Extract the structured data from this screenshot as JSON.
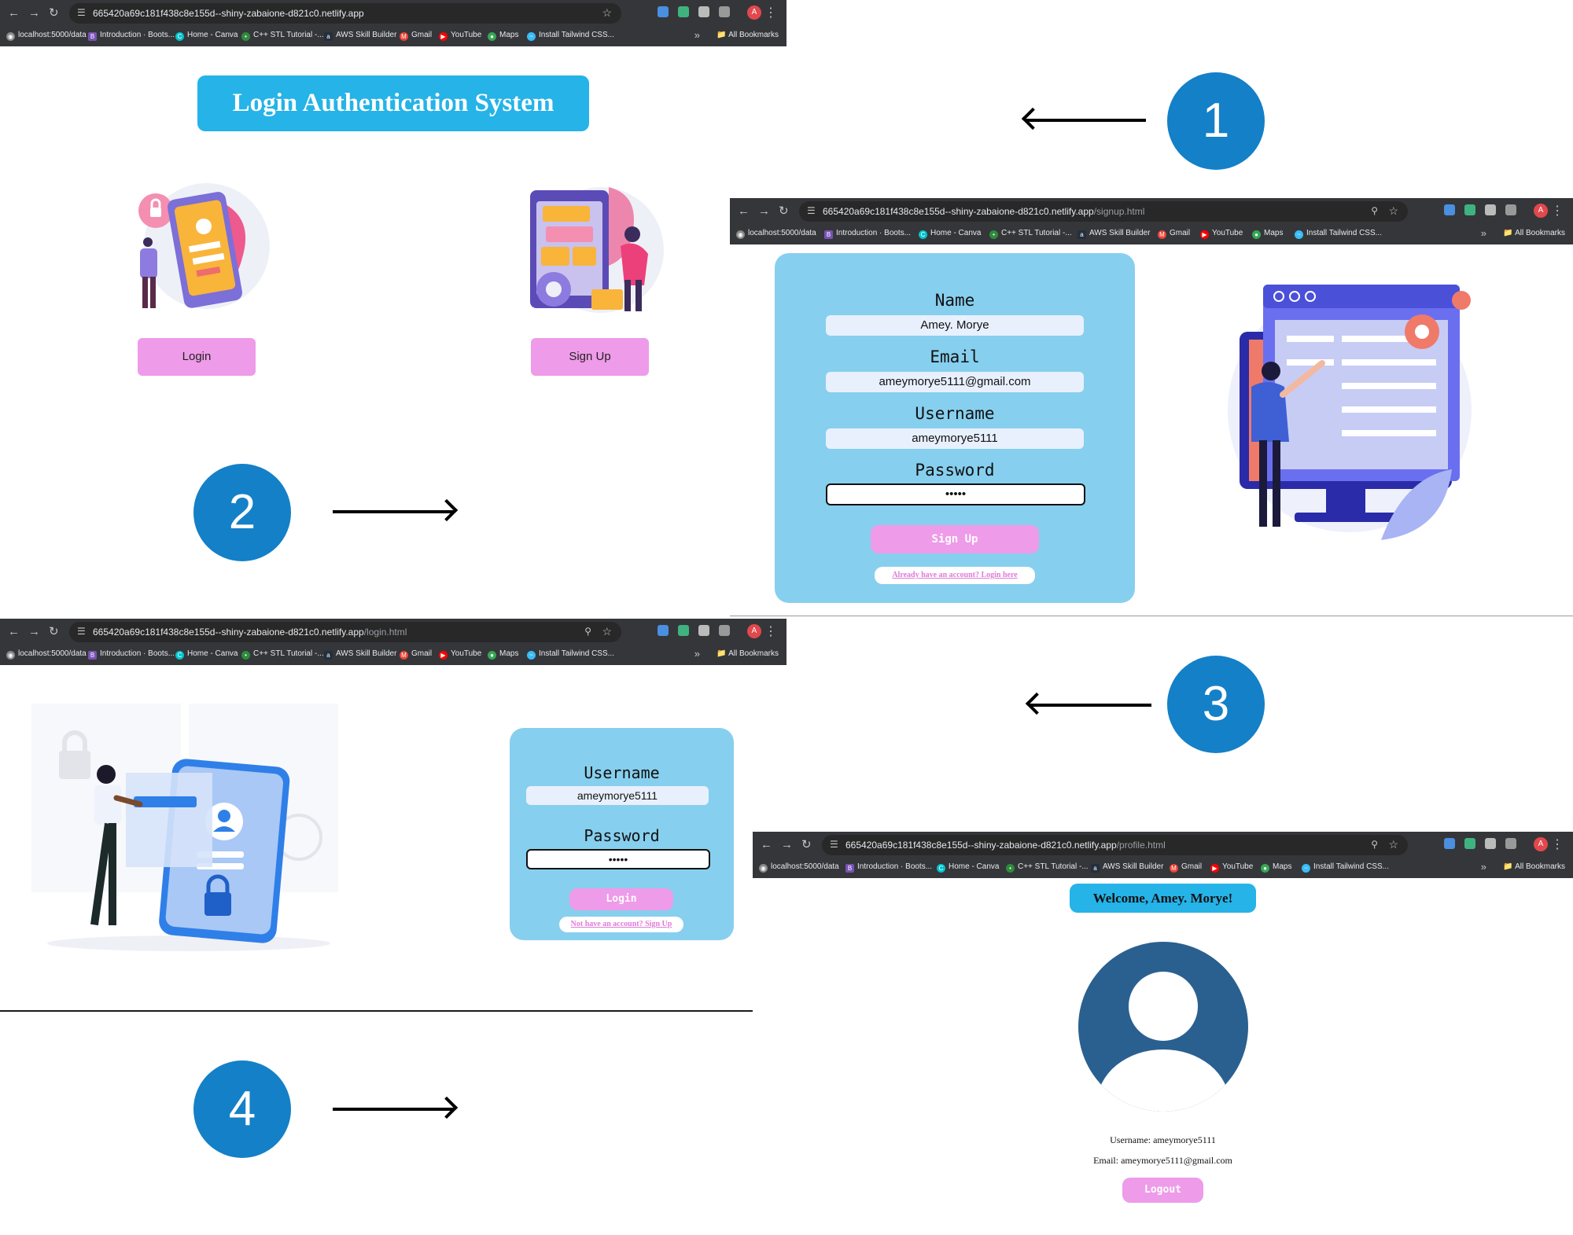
{
  "browser": {
    "host": "665420a69c181f438c8e155d--shiny-zabaione-d821c0.netlify.app",
    "bookmarks": [
      "localhost:5000/data",
      "Introduction · Boots...",
      "Home - Canva",
      "C++ STL Tutorial -...",
      "AWS Skill Builder",
      "Gmail",
      "YouTube",
      "Maps",
      "Install Tailwind CSS..."
    ],
    "all_bookmarks": "All Bookmarks",
    "avatar_letter": "A"
  },
  "screens": {
    "home": {
      "path": "",
      "title": "Login Authentication System",
      "login_button": "Login",
      "signup_button": "Sign Up"
    },
    "signup": {
      "path": "/signup.html",
      "name_label": "Name",
      "name_value": "Amey. Morye",
      "email_label": "Email",
      "email_value": "ameymorye5111@gmail.com",
      "username_label": "Username",
      "username_value": "ameymorye5111",
      "password_label": "Password",
      "password_value": "•••••",
      "submit": "Sign Up",
      "login_link": "Already have an account? Login here"
    },
    "login": {
      "path": "/login.html",
      "username_label": "Username",
      "username_value": "ameymorye5111",
      "password_label": "Password",
      "password_value": "•••••",
      "submit": "Login",
      "signup_link": "Not have an account? Sign Up"
    },
    "profile": {
      "path": "/profile.html",
      "welcome": "Welcome, Amey. Morye!",
      "username_line": "Username: ameymorye5111",
      "email_line": "Email: ameymorye5111@gmail.com",
      "logout": "Logout"
    }
  },
  "steps": [
    "1",
    "2",
    "3",
    "4"
  ],
  "colors": {
    "step": "#1480c7",
    "card": "#87cfee",
    "button": "#ee9be9",
    "banner": "#25b3e8",
    "avatar": "#2a6090"
  }
}
